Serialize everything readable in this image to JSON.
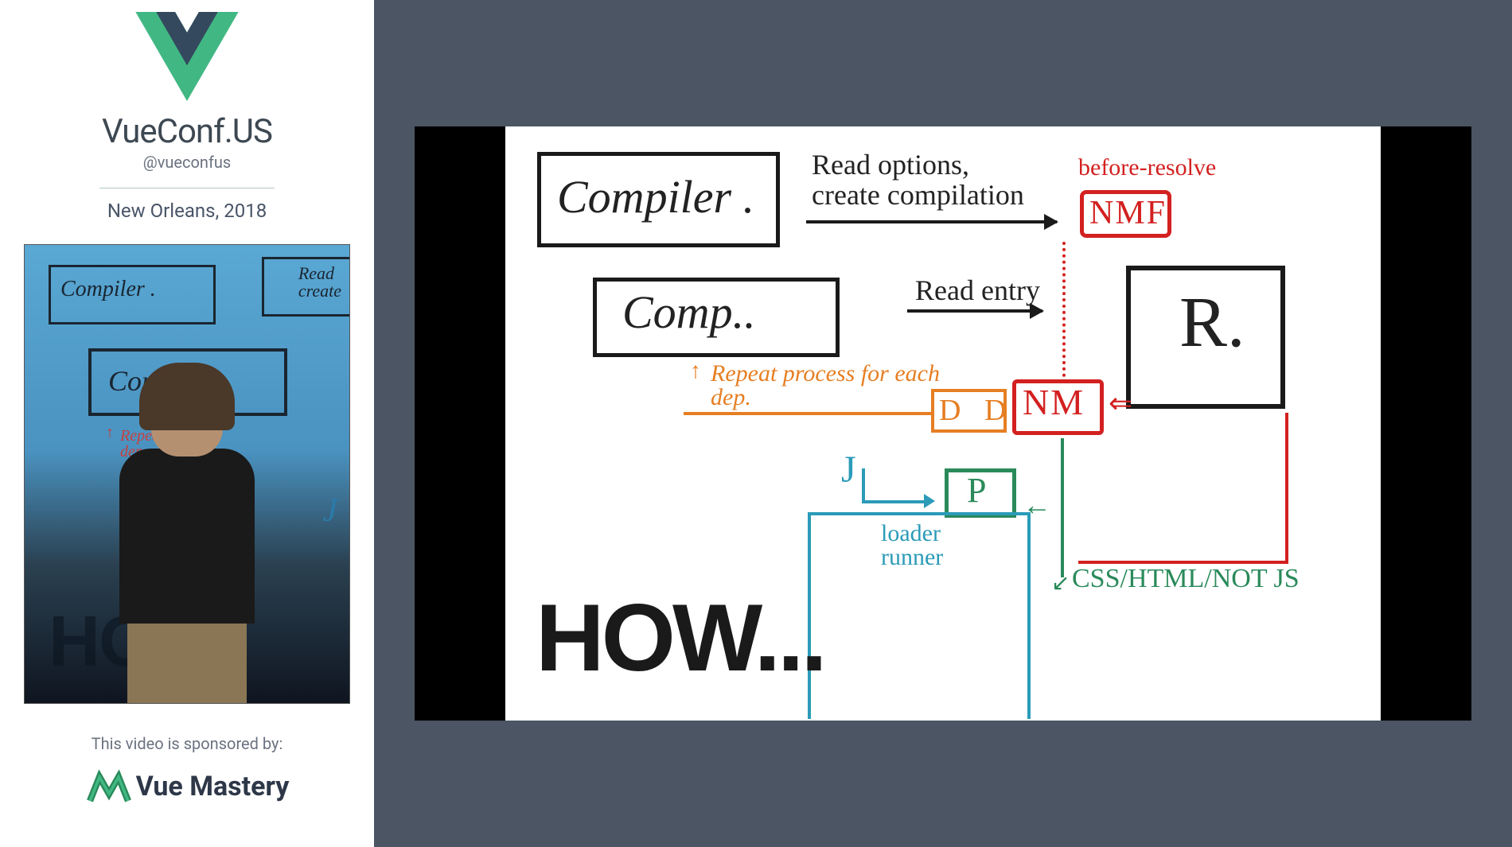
{
  "sidebar": {
    "conf_title": "VueConf.US",
    "conf_handle": "@vueconfus",
    "location": "New Orleans, 2018",
    "sponsor_text": "This video is sponsored by:",
    "sponsor_name": "Vue Mastery",
    "thumb": {
      "compiler": "Compiler .",
      "read_create": "Read\ncreate",
      "comp": "Comp..",
      "repeat": "Repeat process\ndep",
      "j": "J",
      "how": "HO"
    }
  },
  "slide": {
    "compiler": "Compiler .",
    "read_options": "Read options,\ncreate compilation",
    "before_resolve": "before-resolve",
    "nmf": "NMF",
    "comp": "Comp..",
    "read_entry": "Read entry",
    "r": "R.",
    "repeat": "Repeat process for each\ndep.",
    "dd": "D D",
    "nm": "NM",
    "nm_arrow": "⇐",
    "j": "J",
    "p": "P",
    "p_arrow": "←",
    "green_end": "↙",
    "how": "HOW...",
    "loader": "loader\nrunner",
    "css": "CSS/HTML/NOT JS"
  }
}
